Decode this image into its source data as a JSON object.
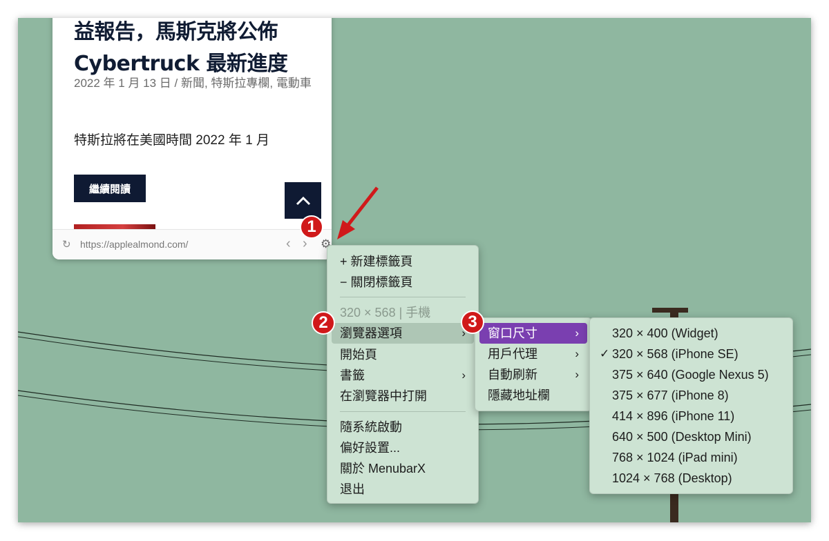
{
  "browser": {
    "article_title": "益報告，馬斯克將公佈 Cybertruck 最新進度",
    "meta": "2022 年 1 月 13 日 / 新聞, 特斯拉專欄, 電動車",
    "excerpt": "特斯拉將在美國時間 2022 年 1 月",
    "read_more": "繼續閱讀",
    "up_icon": "chevron-up",
    "url": "https://applealmond.com/",
    "back_glyph": "‹",
    "forward_glyph": "›",
    "gear_glyph": "⚙",
    "refresh_glyph": "↻",
    "up_glyph": "︿"
  },
  "main_menu": {
    "items": [
      {
        "label": "+ 新建標籤頁"
      },
      {
        "label": "− 關閉標籤頁"
      },
      {
        "label": "320 × 568 | 手機"
      },
      {
        "label": "瀏覽器選項",
        "arrow": "›"
      },
      {
        "label": "開始頁"
      },
      {
        "label": "書籤",
        "arrow": "›"
      },
      {
        "label": "在瀏覽器中打開"
      },
      {
        "label": "隨系統啟動"
      },
      {
        "label": "偏好設置..."
      },
      {
        "label": "關於 MenubarX"
      },
      {
        "label": "退出"
      }
    ]
  },
  "browser_options_menu": {
    "items": [
      {
        "label": "窗口尺寸",
        "arrow": "›"
      },
      {
        "label": "用戶代理",
        "arrow": "›"
      },
      {
        "label": "自動刷新",
        "arrow": "›"
      },
      {
        "label": "隱藏地址欄"
      }
    ]
  },
  "window_size_menu": {
    "checkmark": "✓",
    "items": [
      {
        "label": "320 × 400 (Widget)"
      },
      {
        "label": "320 × 568 (iPhone SE)"
      },
      {
        "label": "375 × 640 (Google Nexus 5)"
      },
      {
        "label": "375 × 677 (iPhone 8)"
      },
      {
        "label": "414 × 896 (iPhone 11)"
      },
      {
        "label": "640 × 500 (Desktop Mini)"
      },
      {
        "label": "768 × 1024 (iPad mini)"
      },
      {
        "label": "1024 × 768 (Desktop)"
      }
    ]
  },
  "annotations": {
    "badge1": "1",
    "badge2": "2",
    "badge3": "3"
  },
  "colors": {
    "desktop": "#8fb7a0",
    "menu_bg": "#cde3d3",
    "highlight": "#7a3fb0",
    "badge": "#d0191a"
  }
}
